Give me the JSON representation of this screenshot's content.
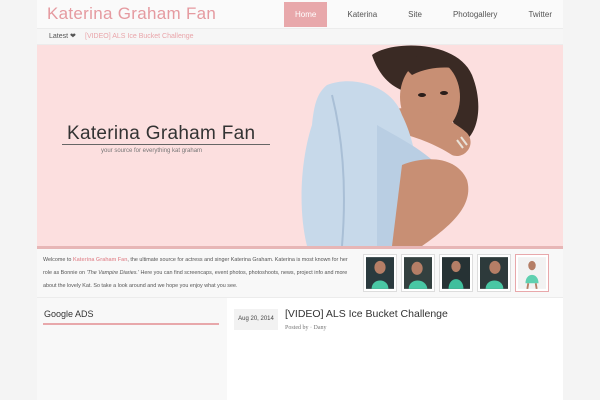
{
  "header": {
    "site_title": "Katerina Graham Fan",
    "nav": [
      {
        "label": "Home",
        "active": true
      },
      {
        "label": "Katerina",
        "active": false
      },
      {
        "label": "Site",
        "active": false
      },
      {
        "label": "Photogallery",
        "active": false
      },
      {
        "label": "Twitter",
        "active": false
      }
    ]
  },
  "ticker": {
    "label": "Latest ❤",
    "link": "[VIDEO] ALS Ice Bucket Challenge"
  },
  "banner": {
    "title": "Katerina Graham Fan",
    "subtitle": "your source for everything kat graham"
  },
  "welcome": {
    "text_1": "Welcome to ",
    "site_name": "Katerina Graham Fan",
    "text_2": ", the ultimate source for actress and singer Katerina Graham. Katerina is most known for her role as Bonnie on ",
    "show": "'The Vampire Diaries.'",
    "text_3": " Here you can find screencaps, event photos, photoshoots, news, project info and more about the lovely Kat. So take a look around and we hope you enjoy what you see."
  },
  "sidebar": {
    "widget_title": "Google ADS"
  },
  "post": {
    "date": "Aug 20, 2014",
    "title": "[VIDEO] ALS Ice Bucket Challenge",
    "meta": "Posted by · Dany"
  },
  "colors": {
    "accent": "#e8a8ab",
    "banner_bg": "#fcdfdf",
    "title_pink": "#e59aa0"
  }
}
